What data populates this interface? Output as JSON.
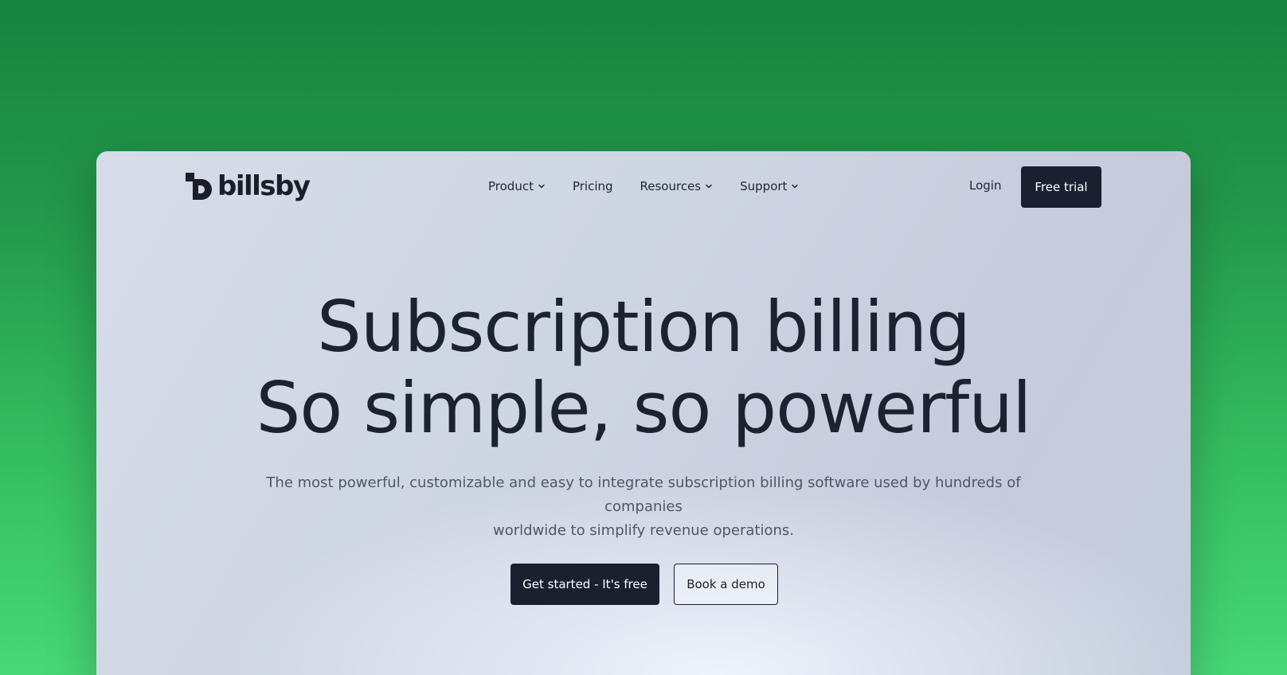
{
  "brand": {
    "name": "billsby",
    "icon": "billsby-logo-icon"
  },
  "nav": {
    "items": [
      {
        "label": "Product",
        "has_dropdown": true
      },
      {
        "label": "Pricing",
        "has_dropdown": false
      },
      {
        "label": "Resources",
        "has_dropdown": true
      },
      {
        "label": "Support",
        "has_dropdown": true
      }
    ],
    "login_label": "Login",
    "free_trial_label": "Free trial"
  },
  "hero": {
    "headline_line1": "Subscription billing",
    "headline_line2": "So simple, so powerful",
    "subtext_line1": "The most powerful, customizable and easy to integrate subscription billing software used by hundreds of companies",
    "subtext_line2": "worldwide to simplify revenue operations.",
    "primary_cta": "Get started - It's free",
    "secondary_cta": "Book a demo"
  },
  "colors": {
    "background_green": "#23974b",
    "dark_button": "#1b2030",
    "text_dark": "#1c2230",
    "text_muted": "#4f5669"
  }
}
